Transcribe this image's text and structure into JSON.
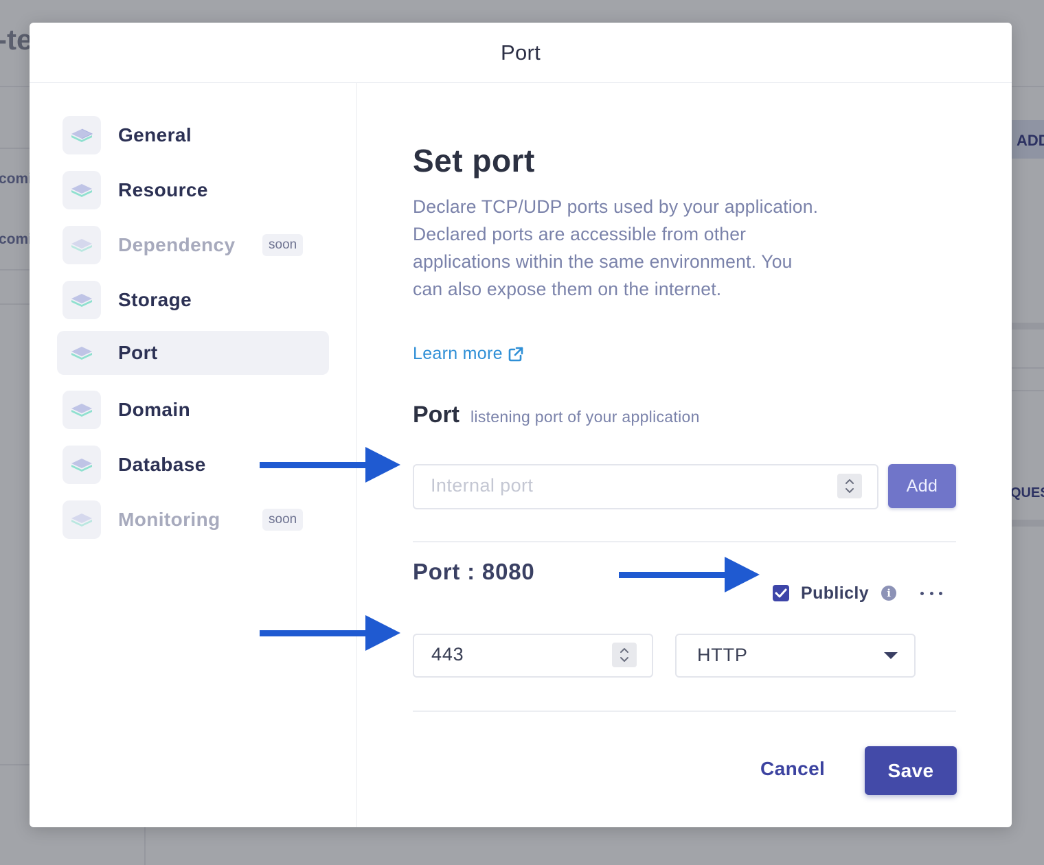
{
  "background": {
    "title_fragment": "-te",
    "left_fragments": [
      "comi",
      "comi"
    ],
    "right_fragments": [
      "ADD",
      "QUES"
    ]
  },
  "modal": {
    "title": "Port"
  },
  "sidebar": {
    "items": [
      {
        "label": "General",
        "state": "normal"
      },
      {
        "label": "Resource",
        "state": "normal"
      },
      {
        "label": "Dependency",
        "state": "disabled",
        "badge": "soon"
      },
      {
        "label": "Storage",
        "state": "normal"
      },
      {
        "label": "Port",
        "state": "active"
      },
      {
        "label": "Domain",
        "state": "normal"
      },
      {
        "label": "Database",
        "state": "normal"
      },
      {
        "label": "Monitoring",
        "state": "disabled",
        "badge": "soon"
      }
    ]
  },
  "main": {
    "heading": "Set port",
    "description": "Declare TCP/UDP ports used by your application. Declared ports are accessible from other applications within the same environment. You can also expose them on the internet.",
    "learn_more": "Learn more",
    "port_section": {
      "title": "Port",
      "subtitle": "listening port of your application",
      "input_placeholder": "Internal port",
      "input_value": "",
      "add_label": "Add"
    },
    "port_entry": {
      "label": "Port : 8080",
      "publicly_label": "Publicly",
      "publicly_checked": true,
      "external_port_value": "443",
      "protocol_selected": "HTTP"
    },
    "actions": {
      "cancel_label": "Cancel",
      "save_label": "Save"
    }
  },
  "colors": {
    "primary": "#434aa8",
    "add_button": "#7075c9",
    "link": "#2f8fd6",
    "annotation_arrow": "#1f5ad1",
    "overlay": "#a2a4a9"
  },
  "icons": [
    "layers-icon",
    "external-link-icon",
    "check-icon",
    "info-icon",
    "more-dots-icon",
    "stepper-icon",
    "caret-down-icon",
    "arrow-right-icon"
  ]
}
